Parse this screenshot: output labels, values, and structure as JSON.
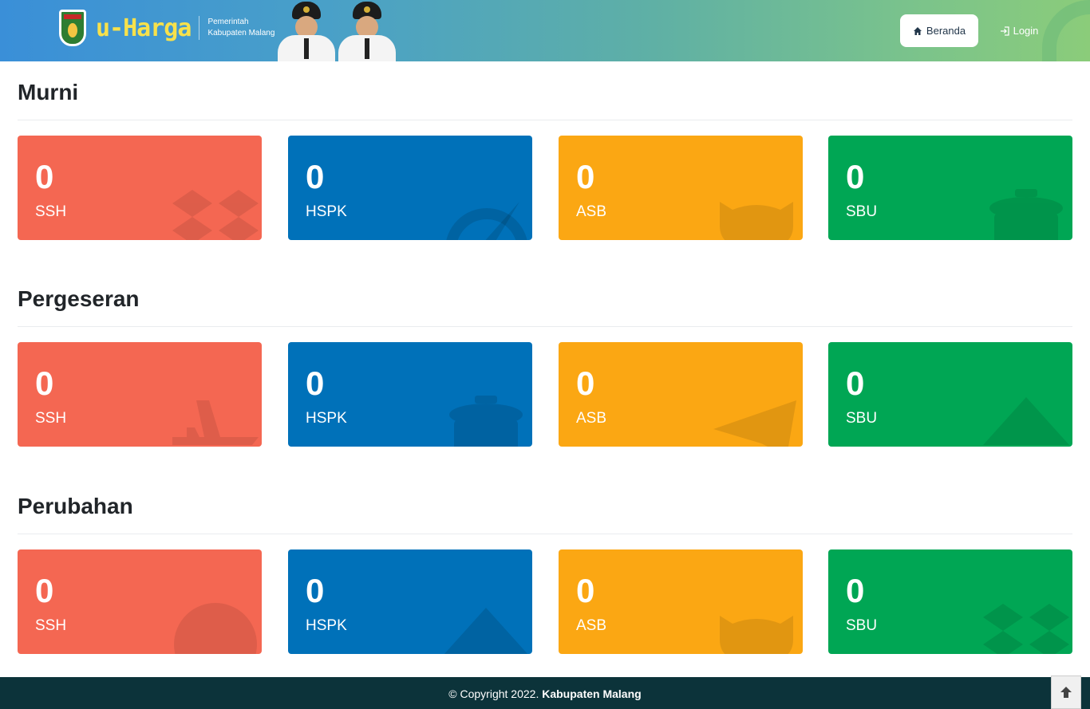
{
  "header": {
    "brand_name": "u-Harga",
    "brand_sub_1": "Pemerintah",
    "brand_sub_2": "Kabupaten Malang",
    "nav": [
      {
        "label": "Beranda",
        "icon": "home-icon",
        "active": true
      },
      {
        "label": "Login",
        "icon": "login-icon",
        "active": false
      }
    ]
  },
  "sections": [
    {
      "title": "Murni",
      "cards": [
        {
          "value": "0",
          "label": "SSH",
          "icon": "dropbox-icon"
        },
        {
          "value": "0",
          "label": "HSPK",
          "icon": "dashboard-icon"
        },
        {
          "value": "0",
          "label": "ASB",
          "icon": "github-icon"
        },
        {
          "value": "0",
          "label": "SBU",
          "icon": "trash-icon"
        }
      ]
    },
    {
      "title": "Pergeseran",
      "cards": [
        {
          "value": "0",
          "label": "SSH",
          "icon": "airplane-icon"
        },
        {
          "value": "0",
          "label": "HSPK",
          "icon": "trash-icon"
        },
        {
          "value": "0",
          "label": "ASB",
          "icon": "paper-plane-icon"
        },
        {
          "value": "0",
          "label": "SBU",
          "icon": "triangle-icon"
        }
      ]
    },
    {
      "title": "Perubahan",
      "cards": [
        {
          "value": "0",
          "label": "SSH",
          "icon": "globe-icon"
        },
        {
          "value": "0",
          "label": "HSPK",
          "icon": "triangle-icon"
        },
        {
          "value": "0",
          "label": "ASB",
          "icon": "github-icon"
        },
        {
          "value": "0",
          "label": "SBU",
          "icon": "dropbox-icon"
        }
      ]
    }
  ],
  "colors": {
    "ssh": "#f46752",
    "hspk": "#0071b9",
    "asb": "#fba713",
    "sbu": "#00a654",
    "footer": "#0c333a"
  },
  "footer": {
    "prefix": "© Copyright 2022. ",
    "org": "Kabupaten Malang"
  }
}
